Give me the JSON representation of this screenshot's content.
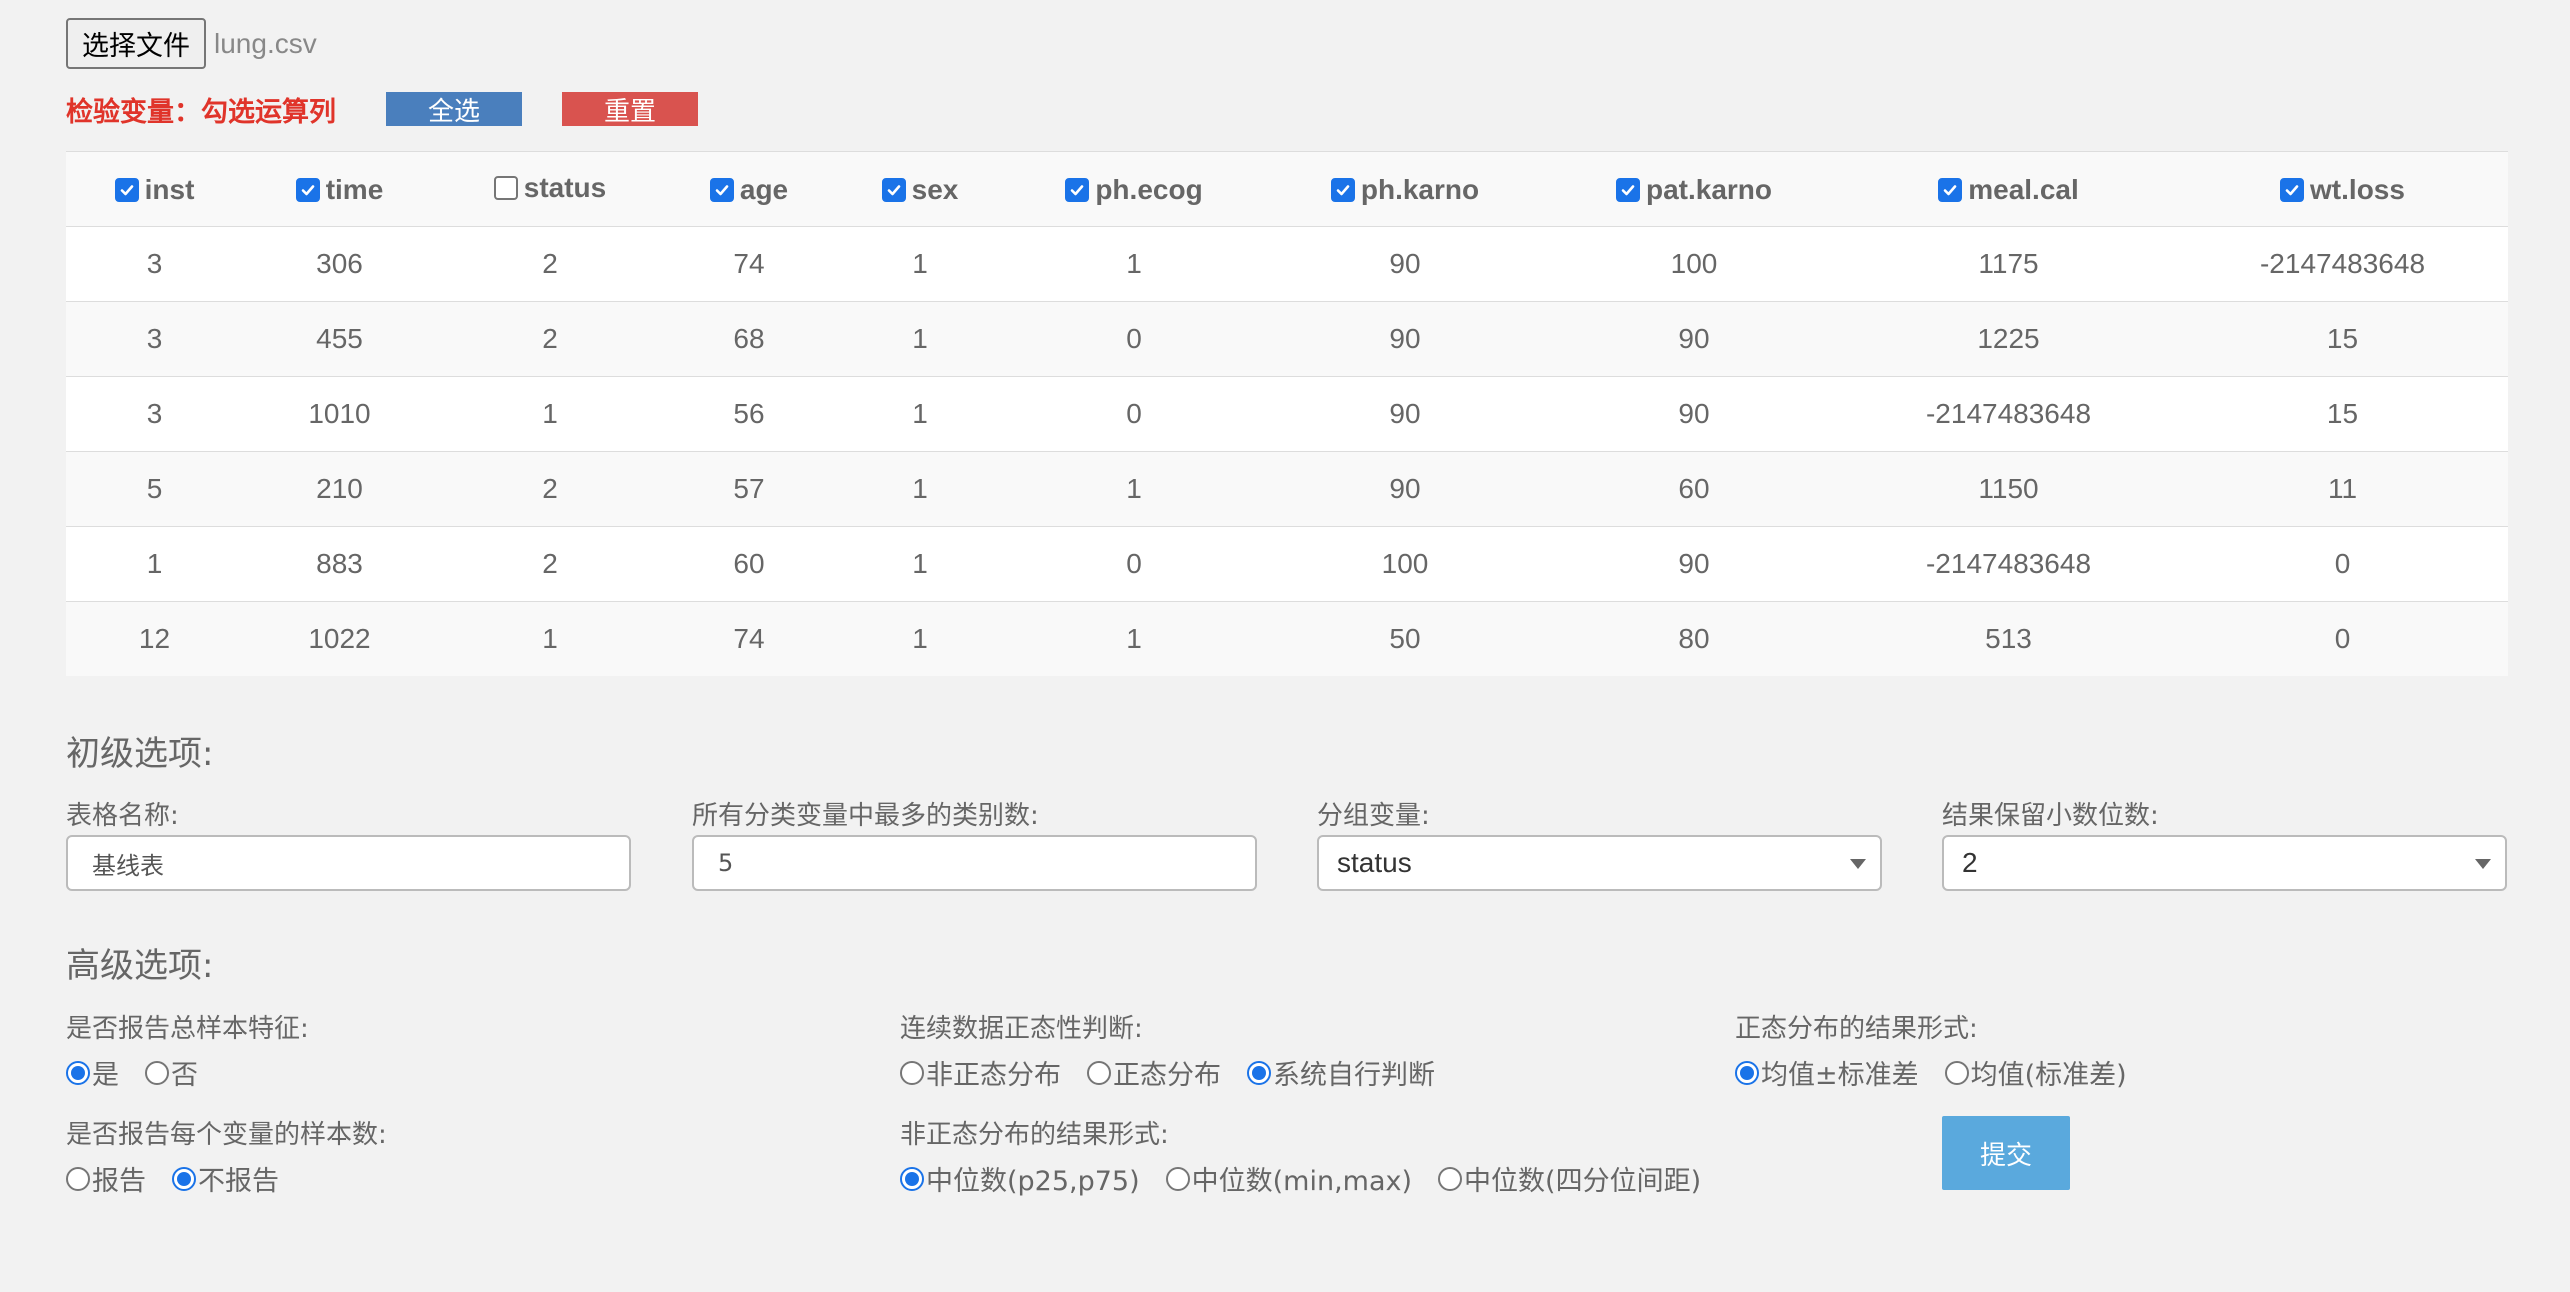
{
  "file": {
    "button_label": "选择文件",
    "file_name": "lung.csv"
  },
  "variables": {
    "label": "检验变量：勾选运算列",
    "select_all_label": "全选",
    "reset_label": "重置"
  },
  "table": {
    "columns": [
      {
        "name": "inst",
        "checked": true
      },
      {
        "name": "time",
        "checked": true
      },
      {
        "name": "status",
        "checked": false
      },
      {
        "name": "age",
        "checked": true
      },
      {
        "name": "sex",
        "checked": true
      },
      {
        "name": "ph.ecog",
        "checked": true
      },
      {
        "name": "ph.karno",
        "checked": true
      },
      {
        "name": "pat.karno",
        "checked": true
      },
      {
        "name": "meal.cal",
        "checked": true
      },
      {
        "name": "wt.loss",
        "checked": true
      }
    ],
    "rows": [
      [
        "3",
        "306",
        "2",
        "74",
        "1",
        "1",
        "90",
        "100",
        "1175",
        "-2147483648"
      ],
      [
        "3",
        "455",
        "2",
        "68",
        "1",
        "0",
        "90",
        "90",
        "1225",
        "15"
      ],
      [
        "3",
        "1010",
        "1",
        "56",
        "1",
        "0",
        "90",
        "90",
        "-2147483648",
        "15"
      ],
      [
        "5",
        "210",
        "2",
        "57",
        "1",
        "1",
        "90",
        "60",
        "1150",
        "11"
      ],
      [
        "1",
        "883",
        "2",
        "60",
        "1",
        "0",
        "100",
        "90",
        "-2147483648",
        "0"
      ],
      [
        "12",
        "1022",
        "1",
        "74",
        "1",
        "1",
        "50",
        "80",
        "513",
        "0"
      ]
    ]
  },
  "basic": {
    "title": "初级选项:",
    "table_name_label": "表格名称:",
    "table_name_value": "基线表",
    "max_categories_label": "所有分类变量中最多的类别数:",
    "max_categories_value": "5",
    "group_var_label": "分组变量:",
    "group_var_value": "status",
    "decimals_label": "结果保留小数位数:",
    "decimals_value": "2"
  },
  "advanced": {
    "title": "高级选项:",
    "report_total_label": "是否报告总样本特征:",
    "report_total_options": [
      {
        "label": "是",
        "selected": true
      },
      {
        "label": "否",
        "selected": false
      }
    ],
    "report_n_label": "是否报告每个变量的样本数:",
    "report_n_options": [
      {
        "label": "报告",
        "selected": false
      },
      {
        "label": "不报告",
        "selected": true
      }
    ],
    "normality_label": "连续数据正态性判断:",
    "normality_options": [
      {
        "label": "非正态分布",
        "selected": false
      },
      {
        "label": "正态分布",
        "selected": false
      },
      {
        "label": "系统自行判断",
        "selected": true
      }
    ],
    "nonnormal_format_label": "非正态分布的结果形式:",
    "nonnormal_format_options": [
      {
        "label": "中位数(p25,p75)",
        "selected": true
      },
      {
        "label": "中位数(min,max)",
        "selected": false
      },
      {
        "label": "中位数(四分位间距)",
        "selected": false
      }
    ],
    "normal_format_label": "正态分布的结果形式:",
    "normal_format_options": [
      {
        "label": "均值±标准差",
        "selected": true
      },
      {
        "label": "均值(标准差)",
        "selected": false
      }
    ],
    "submit_label": "提交"
  },
  "colors": {
    "accent": "#1a73e8",
    "select_all": "#4a7fbd",
    "reset": "#d9534f",
    "warning_text": "#e0342a",
    "submit": "#5aa9dd"
  }
}
